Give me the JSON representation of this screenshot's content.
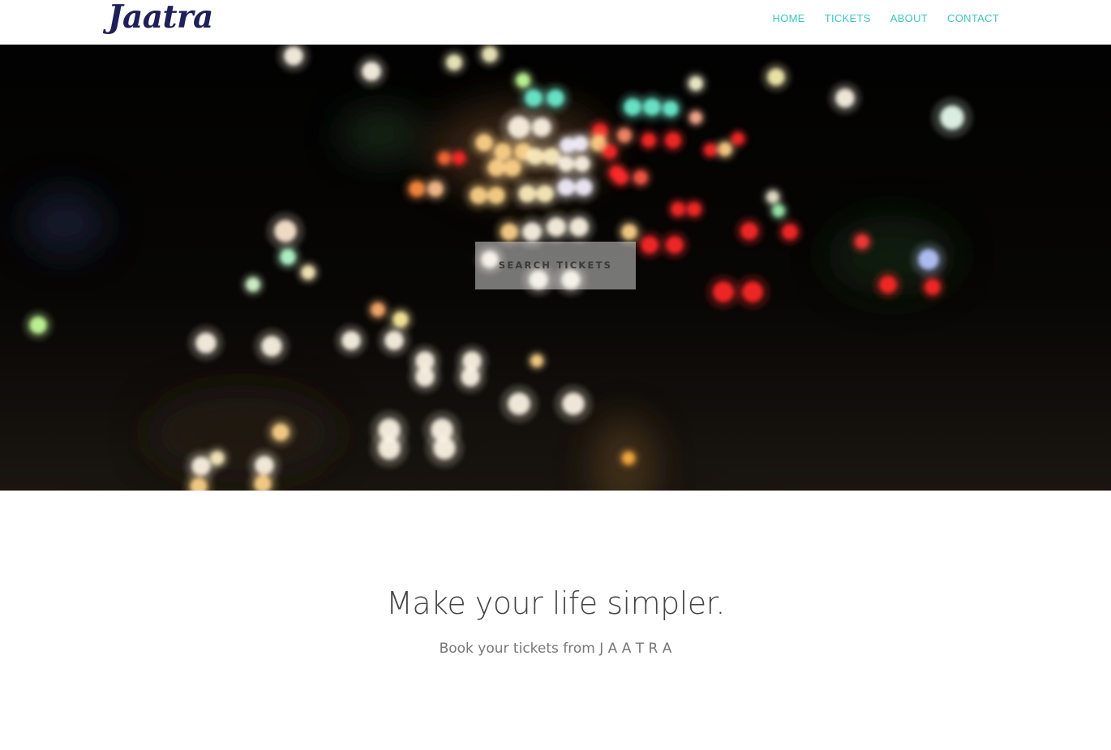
{
  "header": {
    "logo": "Jaatra",
    "nav": [
      {
        "label": "HOME"
      },
      {
        "label": "TICKETS"
      },
      {
        "label": "ABOUT"
      },
      {
        "label": "CONTACT"
      }
    ]
  },
  "hero": {
    "button_label": "SEARCH TICKETS"
  },
  "content": {
    "headline": "Make your life simpler.",
    "subtitle": "Book your tickets from J A A T R A"
  },
  "colors": {
    "accent": "#3ec6bd",
    "logo": "#1f1f5a",
    "headline": "#444444",
    "subtitle": "#777777"
  }
}
